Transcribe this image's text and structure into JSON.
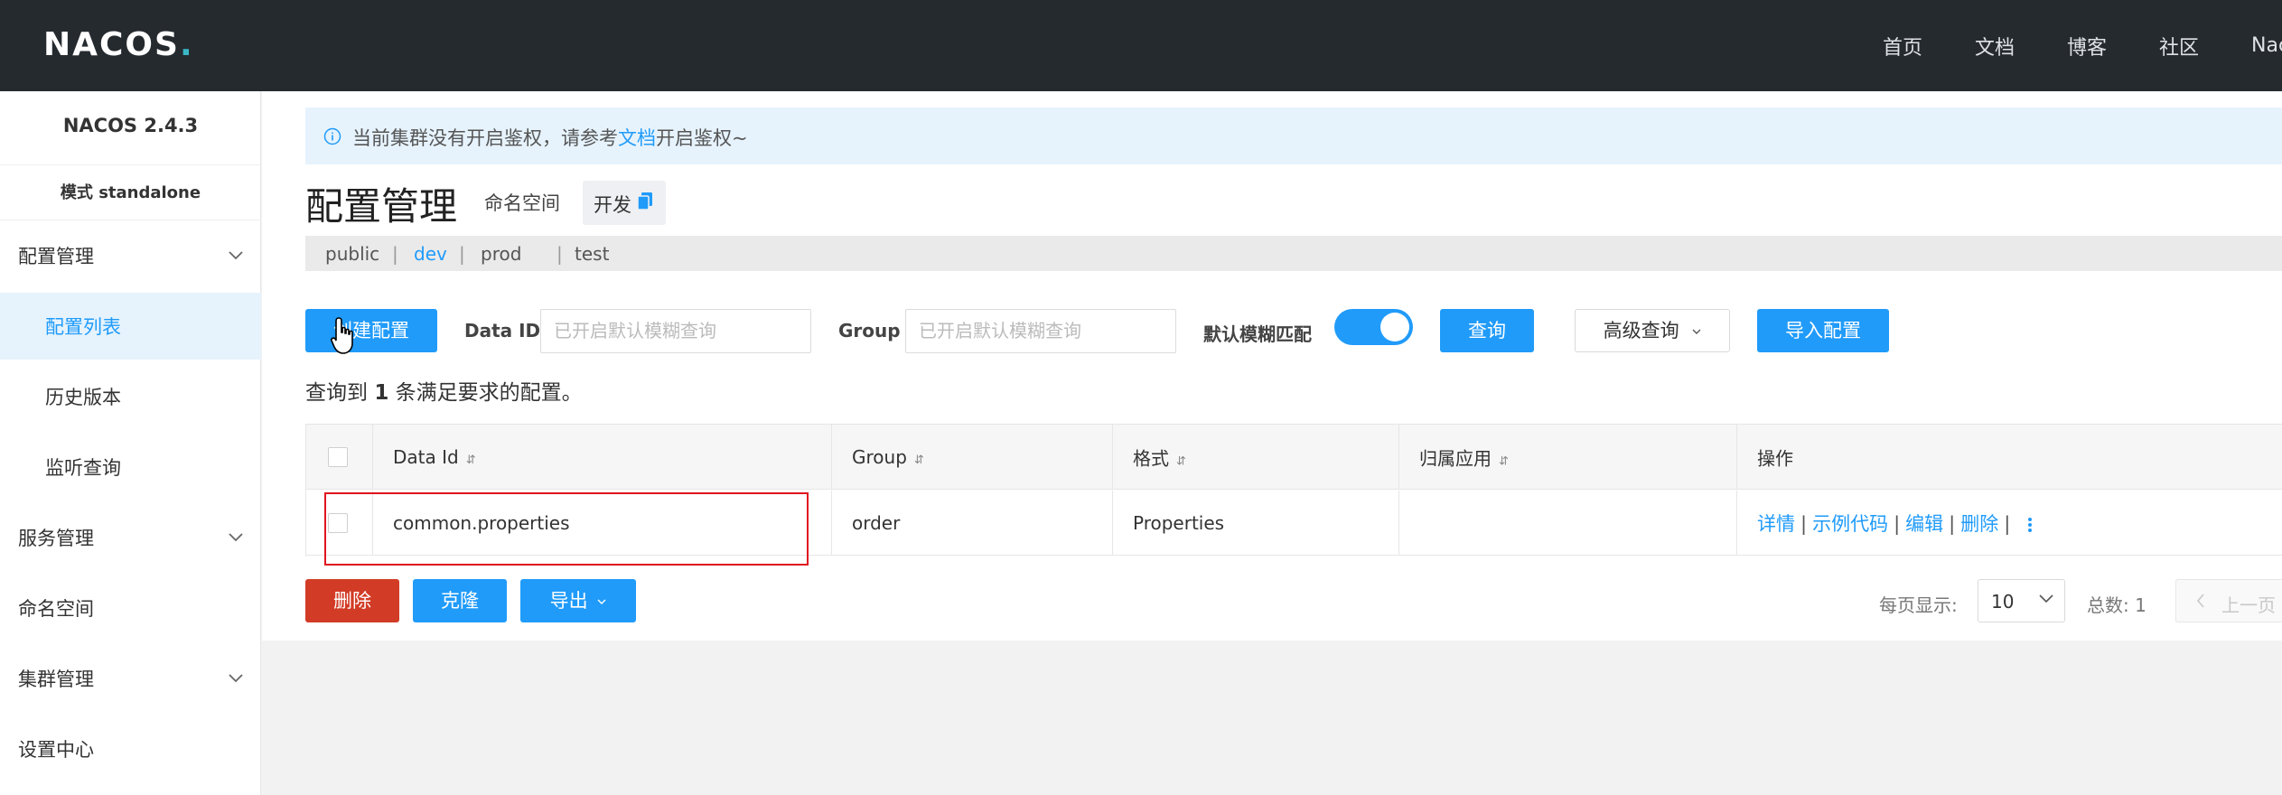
{
  "header": {
    "logo": "NACOS",
    "nav": [
      "首页",
      "文档",
      "博客",
      "社区",
      "Nac"
    ]
  },
  "sidebar": {
    "version": "NACOS 2.4.3",
    "mode": "模式 standalone",
    "items": [
      {
        "label": "配置管理",
        "expandable": true
      },
      {
        "label": "配置列表",
        "active": true
      },
      {
        "label": "历史版本"
      },
      {
        "label": "监听查询"
      },
      {
        "label": "服务管理",
        "expandable": true
      },
      {
        "label": "命名空间"
      },
      {
        "label": "集群管理",
        "expandable": true
      },
      {
        "label": "设置中心"
      }
    ]
  },
  "notice": {
    "text_before": "当前集群没有开启鉴权，请参考",
    "link": "文档",
    "text_after": "开启鉴权~"
  },
  "page": {
    "title": "配置管理",
    "namespace_label": "命名空间",
    "namespace_value": "开发"
  },
  "namespaces": [
    "public",
    "dev",
    "prod",
    "test"
  ],
  "toolbar": {
    "create": "创建配置",
    "data_id_label": "Data ID",
    "data_id_placeholder": "已开启默认模糊查询",
    "group_label": "Group",
    "group_placeholder": "已开启默认模糊查询",
    "fuzzy_label": "默认模糊匹配",
    "fuzzy_on": true,
    "query": "查询",
    "advanced": "高级查询",
    "import": "导入配置"
  },
  "result": {
    "prefix": "查询到",
    "count": "1",
    "suffix": "条满足要求的配置。"
  },
  "table": {
    "columns": [
      "Data Id",
      "Group",
      "格式",
      "归属应用",
      "操作"
    ],
    "rows": [
      {
        "data_id": "common.properties",
        "group": "order",
        "format": "Properties",
        "app": "",
        "actions": [
          "详情",
          "示例代码",
          "编辑",
          "删除"
        ]
      }
    ]
  },
  "bottom": {
    "delete": "删除",
    "clone": "克隆",
    "export": "导出",
    "page_size_label": "每页显示:",
    "page_size": "10",
    "total_label": "总数: 1",
    "prev": "上一页"
  },
  "colors": {
    "primary": "#209bfa",
    "danger": "#d23c26",
    "header_bg": "#252a2f",
    "highlight_box": "#e0141e"
  }
}
